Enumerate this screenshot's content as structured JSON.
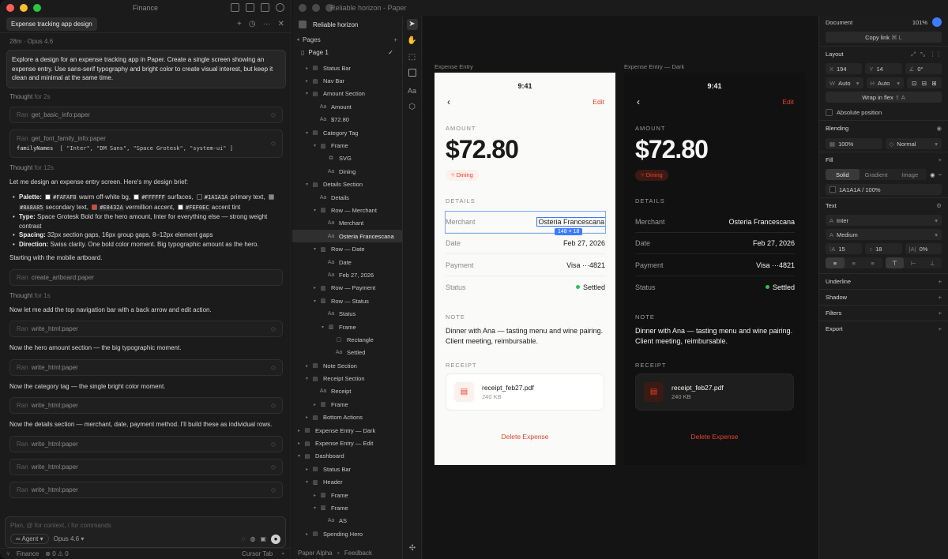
{
  "chat": {
    "window_title": "Finance",
    "tab": "Expense tracking app design",
    "meta": "28m · Opus 4.6",
    "prompt": "Explore a design for an expense tracking app in Paper. Create a single screen showing an expense entry. Use sans-serif typography and bright color to create visual interest, but keep it clean and minimal at the same time.",
    "thought1": "Thought",
    "thought1_time": "for 2s",
    "tool1_ran": "Ran",
    "tool1": "get_basic_info:paper",
    "tool2_ran": "Ran",
    "tool2": "get_font_family_info:paper",
    "tool2_arg_key": "familyNames",
    "tool2_arg_val": "[ \"Inter\", \"DM Sans\", \"Space Grotesk\", \"system-ui\" ]",
    "thought2": "Thought",
    "thought2_time": "for 12s",
    "brief_intro": "Let me design an expense entry screen. Here's my design brief:",
    "b1_label": "Palette:",
    "b1_c1": "#FAFAF8",
    "b1_t1": "warm off-white bg,",
    "b1_c2": "#FFFFFF",
    "b1_t2": "surfaces,",
    "b1_c3": "#1A1A1A",
    "b1_t3": "primary text,",
    "b1_c4": "#8A8A85",
    "b1_t4": "secondary text,",
    "b1_c5": "#E8432A",
    "b1_t5": "vermillion accent,",
    "b1_c6": "#FEF0EC",
    "b1_t6": "accent tint",
    "b2_label": "Type:",
    "b2_text": "Space Grotesk Bold for the hero amount, Inter for everything else — strong weight contrast",
    "b3_label": "Spacing:",
    "b3_text": "32px section gaps, 16px group gaps, 8–12px element gaps",
    "b4_label": "Direction:",
    "b4_text": "Swiss clarity. One bold color moment. Big typographic amount as the hero.",
    "p_start": "Starting with the mobile artboard.",
    "tool3_ran": "Ran",
    "tool3": "create_artboard:paper",
    "thought3": "Thought",
    "thought3_time": "for 1s",
    "p_nav": "Now let me add the top navigation bar with a back arrow and edit action.",
    "tool4_ran": "Ran",
    "tool4": "write_html:paper",
    "p_hero": "Now the hero amount section — the big typographic moment.",
    "tool5_ran": "Ran",
    "tool5": "write_html:paper",
    "p_tag": "Now the category tag — the single bright color moment.",
    "tool6_ran": "Ran",
    "tool6": "write_html:paper",
    "p_details": "Now the details section — merchant, date, payment method. I'll build these as individual rows.",
    "tool7_ran": "Ran",
    "tool7": "write_html:paper",
    "tool8_ran": "Ran",
    "tool8": "write_html:paper",
    "tool9_ran": "Ran",
    "tool9": "write_html:paper",
    "input_placeholder": "Plan, @ for context, / for commands",
    "mode": "Agent",
    "model": "Opus 4.6",
    "status_ws": "Finance",
    "status_err": "0",
    "status_warn": "0",
    "status_right": "Cursor Tab"
  },
  "paper": {
    "window_title": "Reliable horizon - Paper",
    "project": "Reliable horizon",
    "pages_label": "Pages",
    "page1": "Page 1",
    "footer_app": "Paper Alpha",
    "footer_sep": "•",
    "footer_link": "Feedback",
    "layers": [
      {
        "t": "Status Bar",
        "d": 1,
        "c": "▸",
        "i": "▤"
      },
      {
        "t": "Nav Bar",
        "d": 1,
        "c": "▸",
        "i": "▤"
      },
      {
        "t": "Amount Section",
        "d": 1,
        "c": "▾",
        "i": "▤"
      },
      {
        "t": "Amount",
        "d": 2,
        "c": "",
        "i": "Aa"
      },
      {
        "t": "$72.80",
        "d": 2,
        "c": "",
        "i": "Aa"
      },
      {
        "t": "Category Tag",
        "d": 1,
        "c": "▾",
        "i": "▤"
      },
      {
        "t": "Frame",
        "d": 2,
        "c": "▾",
        "i": "▥"
      },
      {
        "t": "SVG",
        "d": 3,
        "c": "",
        "i": "⧉"
      },
      {
        "t": "Dining",
        "d": 3,
        "c": "",
        "i": "Aa"
      },
      {
        "t": "Details Section",
        "d": 1,
        "c": "▾",
        "i": "▤"
      },
      {
        "t": "Details",
        "d": 2,
        "c": "",
        "i": "Aa"
      },
      {
        "t": "Row — Merchant",
        "d": 2,
        "c": "▾",
        "i": "▥"
      },
      {
        "t": "Merchant",
        "d": 3,
        "c": "",
        "i": "Aa"
      },
      {
        "t": "Osteria Francescana",
        "d": 3,
        "c": "",
        "i": "Aa",
        "sel": true
      },
      {
        "t": "Row — Date",
        "d": 2,
        "c": "▾",
        "i": "▥"
      },
      {
        "t": "Date",
        "d": 3,
        "c": "",
        "i": "Aa"
      },
      {
        "t": "Feb 27, 2026",
        "d": 3,
        "c": "",
        "i": "Aa"
      },
      {
        "t": "Row — Payment",
        "d": 2,
        "c": "▸",
        "i": "▥"
      },
      {
        "t": "Row — Status",
        "d": 2,
        "c": "▾",
        "i": "▥"
      },
      {
        "t": "Status",
        "d": 3,
        "c": "",
        "i": "Aa"
      },
      {
        "t": "Frame",
        "d": 3,
        "c": "▾",
        "i": "▥"
      },
      {
        "t": "Rectangle",
        "d": 4,
        "c": "",
        "i": "▢"
      },
      {
        "t": "Settled",
        "d": 4,
        "c": "",
        "i": "Aa"
      },
      {
        "t": "Note Section",
        "d": 1,
        "c": "▸",
        "i": "▤"
      },
      {
        "t": "Receipt Section",
        "d": 1,
        "c": "▾",
        "i": "▤"
      },
      {
        "t": "Receipt",
        "d": 2,
        "c": "",
        "i": "Aa"
      },
      {
        "t": "Frame",
        "d": 2,
        "c": "▸",
        "i": "▥"
      },
      {
        "t": "Bottom Actions",
        "d": 1,
        "c": "▸",
        "i": "▤"
      },
      {
        "t": "Expense Entry — Dark",
        "d": 0,
        "c": "▸",
        "i": "▤"
      },
      {
        "t": "Expense Entry — Edit",
        "d": 0,
        "c": "▸",
        "i": "▤"
      },
      {
        "t": "Dashboard",
        "d": 0,
        "c": "▾",
        "i": "▤"
      },
      {
        "t": "Status Bar",
        "d": 1,
        "c": "▸",
        "i": "▤"
      },
      {
        "t": "Header",
        "d": 1,
        "c": "▾",
        "i": "▥"
      },
      {
        "t": "Frame",
        "d": 2,
        "c": "▸",
        "i": "▥"
      },
      {
        "t": "Frame",
        "d": 2,
        "c": "▾",
        "i": "▥"
      },
      {
        "t": "AS",
        "d": 3,
        "c": "",
        "i": "Aa"
      },
      {
        "t": "Spending Hero",
        "d": 1,
        "c": "▸",
        "i": "▤"
      }
    ],
    "artboard_light": "Expense Entry",
    "artboard_dark": "Expense Entry — Dark",
    "selection_size": "148 × 18",
    "screen": {
      "time": "9:41",
      "edit": "Edit",
      "amount_label": "AMOUNT",
      "amount": "$72.80",
      "tag": "Dining",
      "details_label": "DETAILS",
      "merchant_k": "Merchant",
      "merchant_v": "Osteria Francescana",
      "date_k": "Date",
      "date_v": "Feb 27, 2026",
      "payment_k": "Payment",
      "payment_v": "Visa ···4821",
      "status_k": "Status",
      "status_v": "Settled",
      "note_label": "NOTE",
      "note": "Dinner with Ana — tasting menu and wine pairing. Client meeting, reimbursable.",
      "receipt_label": "RECEIPT",
      "file": "receipt_feb27.pdf",
      "file_size": "240 KB",
      "delete": "Delete Expense"
    },
    "inspector": {
      "document": "Document",
      "zoom": "101%",
      "copy_link": "Copy link",
      "copy_shortcut": "⌘ L",
      "layout": "Layout",
      "x_lbl": "X",
      "x": "194",
      "y_lbl": "Y",
      "y": "14",
      "rot": "0°",
      "w_lbl": "W",
      "w": "Auto",
      "h_lbl": "H",
      "h": "Auto",
      "wrap": "Wrap in flex",
      "wrap_sc": "⇧ A",
      "absolute": "Absolute position",
      "blending": "Blending",
      "opacity": "100%",
      "blend_mode": "Normal",
      "fill": "Fill",
      "fill_solid": "Solid",
      "fill_gradient": "Gradient",
      "fill_image": "Image",
      "fill_value": "1A1A1A / 100%",
      "text": "Text",
      "font": "Inter",
      "weight": "Medium",
      "size": "15",
      "line_height": "18",
      "letter": "0%",
      "underline": "Underline",
      "shadow": "Shadow",
      "filters": "Filters",
      "export": "Export"
    }
  },
  "colors": {
    "accent": "#E8432A",
    "accent_tint": "#FEF0EC",
    "bg": "#FAFAF8",
    "primary": "#1A1A1A",
    "secondary": "#8A8A85",
    "selection": "#3D7BFF",
    "settled": "#2FBF5A"
  }
}
